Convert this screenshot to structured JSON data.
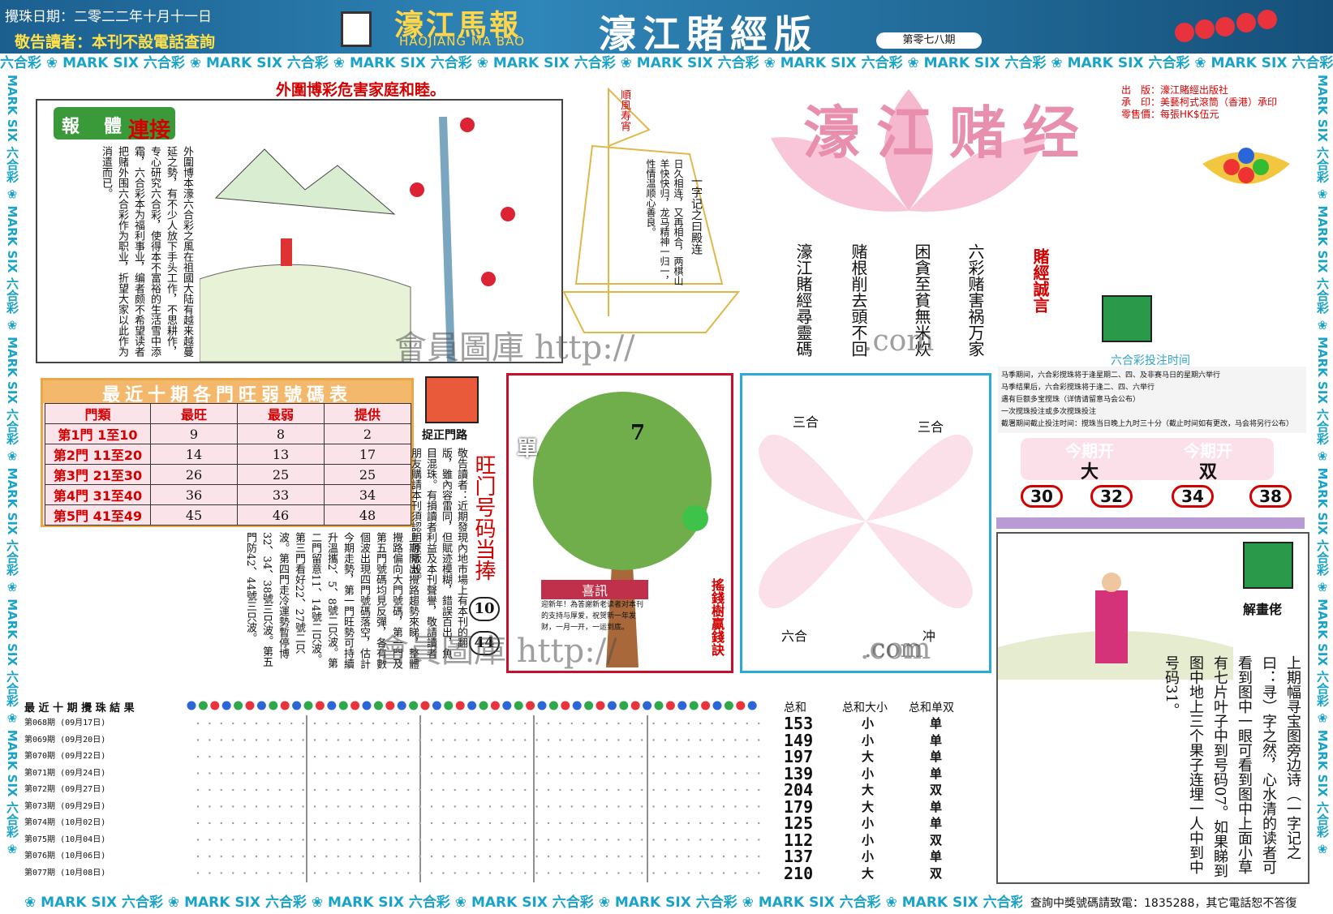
{
  "header": {
    "date": "攪珠日期：二零二二年十月十一日",
    "warning": "敬告讀者：本刊不設電話查詢",
    "brand": "濠江馬報",
    "brand_en": "HAOJIANG MA BAO",
    "edition": "濠江賭經版",
    "issue": "第零七八期",
    "colors": {
      "bar": "#1b5f8f",
      "warning": "#ffe14a"
    }
  },
  "strip_text": "六合彩 ❀ MARK SIX 六合彩 ❀ MARK SIX 六合彩 ❀ MARK SIX 六合彩 ❀ MARK SIX 六合彩 ❀ MARK SIX 六合彩 ❀ MARK SIX 六合彩 ❀ MARK SIX 六合彩 ❀ MARK SIX 六合彩 ❀ MARK SIX 六合彩 ❀ MARK SIX 六合彩 ❀ MARK SIX",
  "vstrip_text": "MARK SIX 六合彩 ❀ MARK SIX 六合彩 ❀ MARK SIX 六合彩 ❀ MARK SIX 六合彩 ❀ MARK SIX 六合彩 ❀ MARK SIX 六合彩 ❀ MARK SIX 六合彩 ❀",
  "bottom_strip": "❀ MARK SIX 六合彩 ❀ MARK SIX 六合彩 ❀ MARK SIX 六合彩 ❀ MARK SIX 六合彩 ❀ MARK SIX 六合彩 ❀ MARK SIX 六合彩 ❀ MARK SIX 六合彩 ❀ MA",
  "hotline": "查詢中獎號碼請致電：1835288，其它電話恕不答復",
  "story": {
    "title": "外圍博彩危害家庭和睦。",
    "badge1": "報",
    "badge2": "體",
    "badge3": "連接",
    "text": "外圍博本濠六合彩之風在祖國大陆有越来越蔓延之勢，有不少人放下手头工作，不思耕作，专心研究六合彩，使得本不富裕的生活雪中添霜，六合彩本为福利事业，编者颇不希望读者把赌外围六合彩作为职业，折望大家以此作为消遣而已。"
  },
  "sail": {
    "flag": "順風寿宵",
    "poem_title": "一字记之曰殿连",
    "poem": "日久相连，又再相合，两棋山羊快快归，龙马精神一归一，性情温顺心善良。"
  },
  "center_banner": [
    "六彩赌害祸万家",
    "困貪至貧無米炊",
    "赌根削去頭不回",
    "濠江賭經尋靈碼"
  ],
  "logo_big": "濠江赌经",
  "motto": "賭經誠言",
  "publisher": [
    {
      "k": "出　版：",
      "v": "濠江賭經出版社"
    },
    {
      "k": "承　印：",
      "v": "美藝柯式滾筒（香港）承印"
    },
    {
      "k": "零售價：",
      "v": "每張HK$伍元"
    }
  ],
  "schedule": {
    "title": "六合彩投注时间",
    "items": [
      "马季期间，六合彩搅珠将于逢星期二、四、及非赛马日的星期六举行",
      "马季结果后，六合彩搅珠将于逢二、四、六举行",
      "遇有巨额多宝搅珠（详情请留意马会公布）",
      "一次搅珠投注或多次搅珠投注",
      "截署期间截止投注时间：搅珠当日晚上九时三十分（截止时间如有更改，马会将另行公布）"
    ]
  },
  "this_issue": {
    "label1": "今期开",
    "value1": "大",
    "label2": "今期开",
    "value2": "双",
    "numbers": [
      "30",
      "32",
      "34",
      "38"
    ]
  },
  "weak_table": {
    "title": "最近十期各門旺弱號碼表",
    "headers": [
      "門類",
      "最旺",
      "最弱",
      "提供"
    ],
    "rows": [
      {
        "gate": "第1門",
        "a": "1",
        "b": "10",
        "hot": "9",
        "cold": "8",
        "tip": "2"
      },
      {
        "gate": "第2門",
        "a": "11",
        "b": "20",
        "hot": "14",
        "cold": "13",
        "tip": "17"
      },
      {
        "gate": "第3門",
        "a": "21",
        "b": "30",
        "hot": "26",
        "cold": "25",
        "tip": "25"
      },
      {
        "gate": "第4門",
        "a": "31",
        "b": "40",
        "hot": "36",
        "cold": "33",
        "tip": "34"
      },
      {
        "gate": "第5門",
        "a": "41",
        "b": "49",
        "hot": "45",
        "cold": "46",
        "tip": "48"
      }
    ],
    "sep": "至"
  },
  "gate_path": {
    "label": "捉正門路",
    "notice": "敬告讀者：近期發現內地市場上有本刊的翻版，雖內容雷同，但賦迹模糊，錯誤百出，魚目混珠。有損讀者利益及本刊聲譽，敬請讀者朋友購請本刊須認明原版設。",
    "analysis": "上期開出攪路趨勢來睇，整體攪路偏向大門號碼，第一門及第五門號碼均見反彈，各有數個波出現四門號碼落空，估計今期走勢，第一門旺勢可持續升溫攜2、5、8號二只波。第二門留意11、14號二只波。第三門看好22、27號二只波。第四門走冷運勢暫停博32、34、38號三只波。第五門防42、44號三只波。",
    "hot_title": "旺门号码当捧",
    "hot_nums": [
      "10",
      "44"
    ]
  },
  "tree": {
    "label_single": "單",
    "label_num": "7",
    "caption": "搖錢樹贏錢訣",
    "notice_title": "喜訊",
    "notice_text": "迎新年！為答謝新老读者对本刊的支持与厚爱，祝贺新一年发财，一月一开，一运到底。"
  },
  "zodiac": {
    "labels": [
      "三合",
      "三合",
      "六合",
      "冲"
    ],
    "watermark": ".com"
  },
  "watermarks": [
    "會員圖庫 http://",
    ".com",
    "會員圖庫 http://",
    ".com"
  ],
  "riddle": {
    "label": "解畫佬",
    "text": "上期幅寻宝图旁边诗（一字记之曰：寻）字之然，心水清的读者可看到图中一眼可看到图中上面小草有七片叶子中到号码07。如果睇到图中地上三个果子连埋一人中到中号码31。"
  },
  "results": {
    "title": "最 近 十 期 攪 珠 結 果",
    "col_sum": "总和",
    "col_size": "总和大小",
    "col_parity": "总和单双",
    "rows": [
      {
        "period": "第068期",
        "date": "(09月17日)",
        "sum": "153",
        "size": "小",
        "parity": "单"
      },
      {
        "period": "第069期",
        "date": "(09月20日)",
        "sum": "149",
        "size": "小",
        "parity": "单"
      },
      {
        "period": "第070期",
        "date": "(09月22日)",
        "sum": "197",
        "size": "大",
        "parity": "单"
      },
      {
        "period": "第071期",
        "date": "(09月24日)",
        "sum": "139",
        "size": "小",
        "parity": "单"
      },
      {
        "period": "第072期",
        "date": "(09月27日)",
        "sum": "204",
        "size": "大",
        "parity": "双"
      },
      {
        "period": "第073期",
        "date": "(09月29日)",
        "sum": "179",
        "size": "大",
        "parity": "单"
      },
      {
        "period": "第074期",
        "date": "(10月02日)",
        "sum": "125",
        "size": "小",
        "parity": "单"
      },
      {
        "period": "第075期",
        "date": "(10月04日)",
        "sum": "112",
        "size": "小",
        "parity": "双"
      },
      {
        "period": "第076期",
        "date": "(10月06日)",
        "sum": "137",
        "size": "小",
        "parity": "单"
      },
      {
        "period": "第077期",
        "date": "(10月08日)",
        "sum": "210",
        "size": "大",
        "parity": "双"
      }
    ]
  }
}
